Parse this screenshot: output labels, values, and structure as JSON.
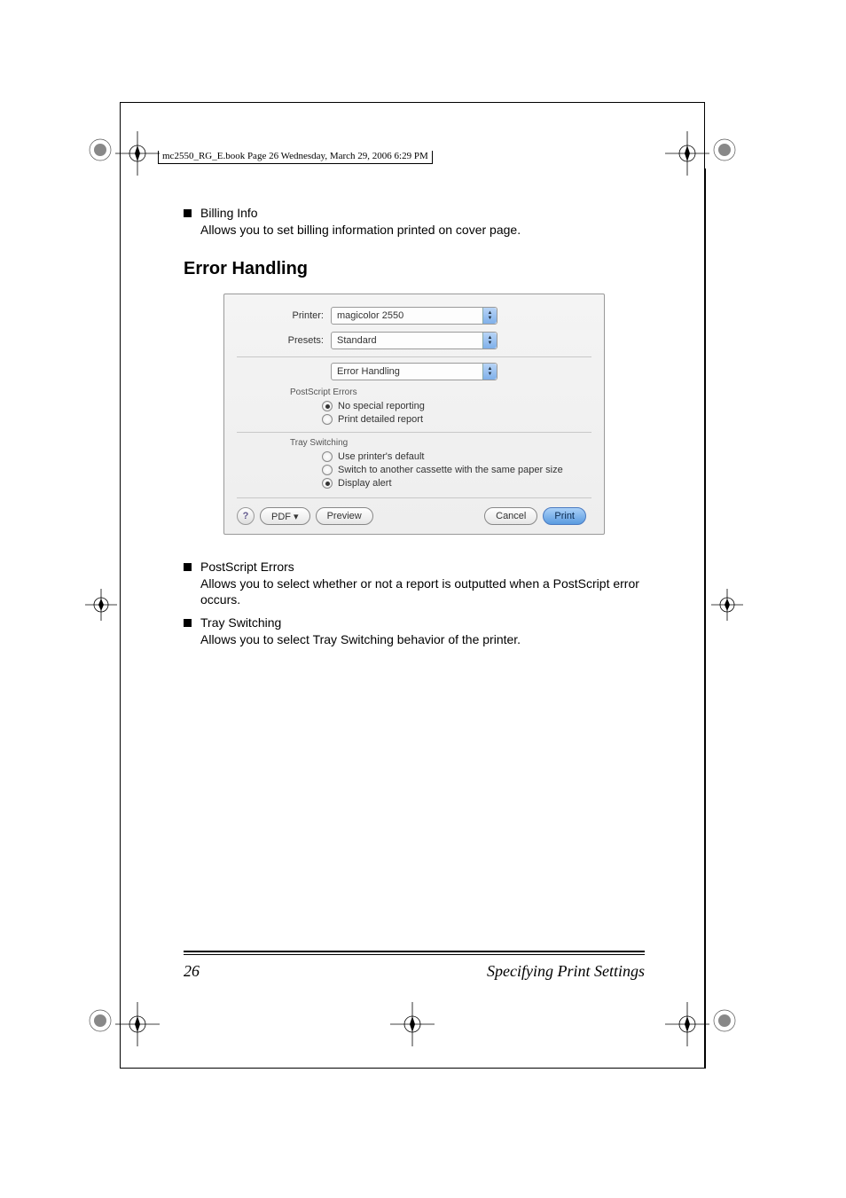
{
  "header": {
    "running_head": "mc2550_RG_E.book  Page 26  Wednesday, March 29, 2006  6:29 PM"
  },
  "bullets_top": {
    "billing_info_title": "Billing Info",
    "billing_info_desc": "Allows you to set billing information printed on cover page."
  },
  "section_heading": "Error Handling",
  "dialog": {
    "printer_label": "Printer:",
    "printer_value": "magicolor 2550",
    "presets_label": "Presets:",
    "presets_value": "Standard",
    "pane_value": "Error Handling",
    "ps_errors_label": "PostScript Errors",
    "ps_option_1": "No special reporting",
    "ps_option_2": "Print detailed report",
    "tray_label": "Tray Switching",
    "tray_option_1": "Use printer's default",
    "tray_option_2": "Switch to another cassette with the same paper size",
    "tray_option_3": "Display alert",
    "help": "?",
    "pdf": "PDF ▾",
    "preview": "Preview",
    "cancel": "Cancel",
    "print": "Print"
  },
  "bullets_bottom": {
    "ps_title": "PostScript Errors",
    "ps_desc": "Allows you to select whether or not a report is outputted when a Post­Script error occurs.",
    "tray_title": "Tray Switching",
    "tray_desc": "Allows you to select Tray Switching behavior of the printer."
  },
  "footer": {
    "page_number": "26",
    "title": "Specifying Print Settings"
  }
}
